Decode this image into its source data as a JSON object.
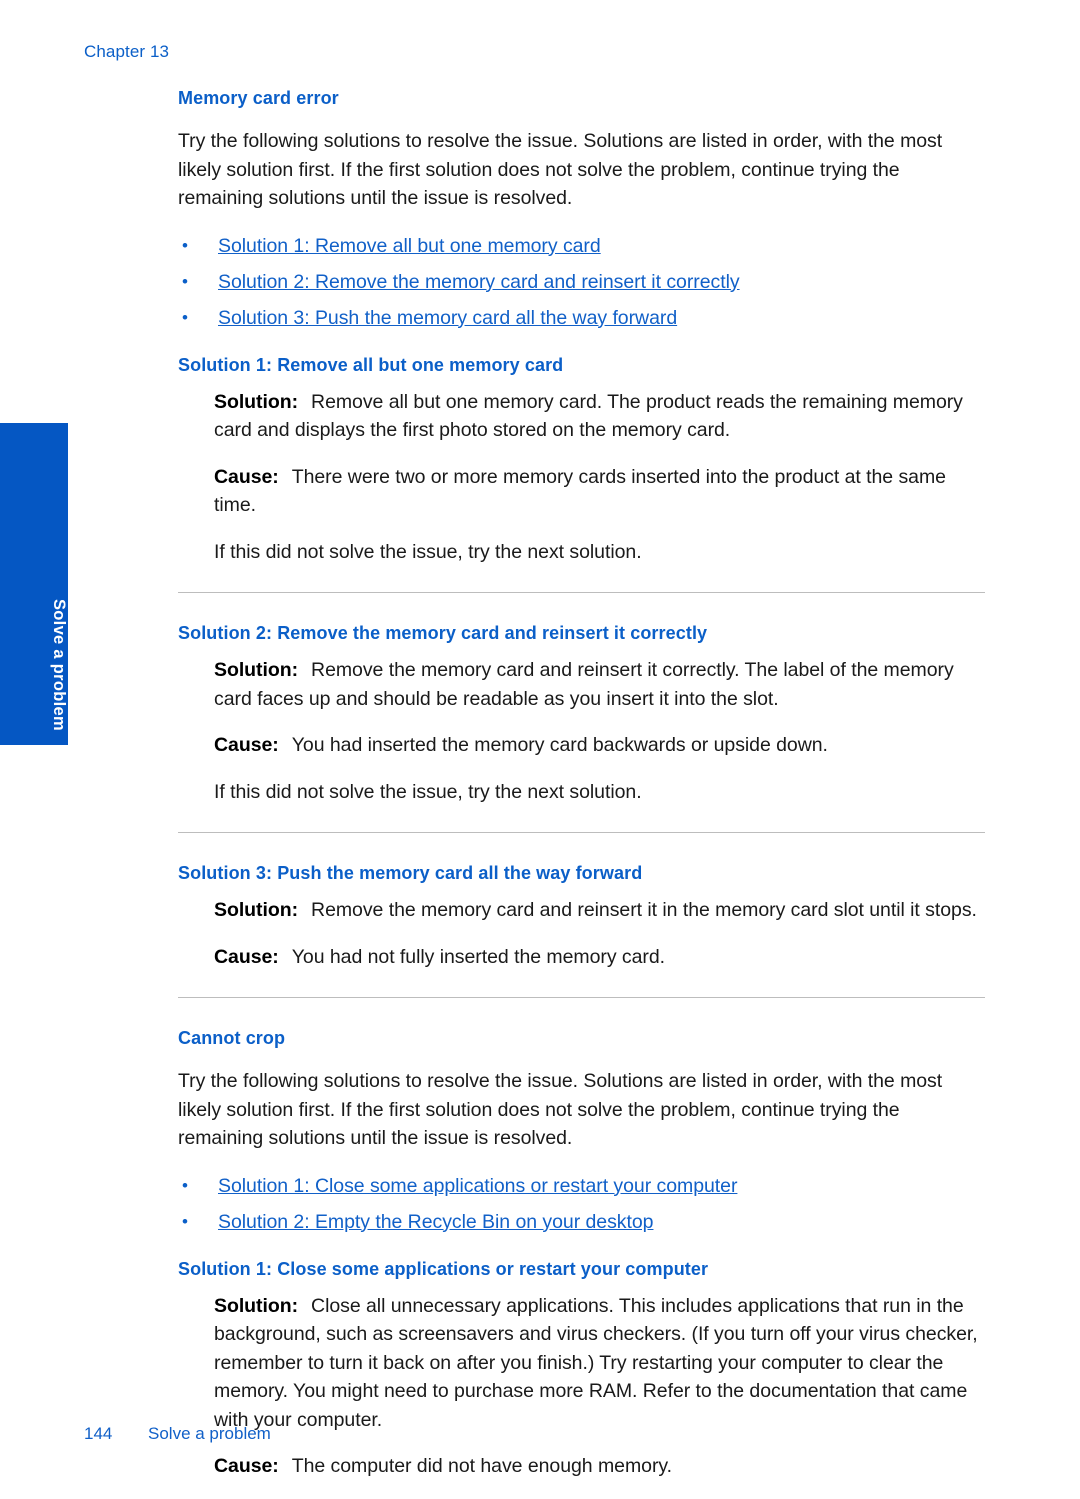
{
  "page": {
    "chapter_label": "Chapter 13",
    "side_tab_label": "Solve a problem",
    "footer_page_number": "144",
    "footer_section": "Solve a problem",
    "accent_blue": "#0B5FC8",
    "tab_blue": "#0557C3",
    "link_blue": "#1160C8",
    "rule_color": "#bdbdbd"
  },
  "sections": {
    "memory_card_error": {
      "title": "Memory card error",
      "intro": "Try the following solutions to resolve the issue. Solutions are listed in order, with the most likely solution first. If the first solution does not solve the problem, continue trying the remaining solutions until the issue is resolved.",
      "links": [
        "Solution 1: Remove all but one memory card",
        "Solution 2: Remove the memory card and reinsert it correctly",
        "Solution 3: Push the memory card all the way forward"
      ],
      "solutions": [
        {
          "heading": "Solution 1: Remove all but one memory card",
          "solution_label": "Solution:",
          "solution_text": "Remove all but one memory card. The product reads the remaining memory card and displays the first photo stored on the memory card.",
          "cause_label": "Cause:",
          "cause_text": "There were two or more memory cards inserted into the product at the same time.",
          "next_text": "If this did not solve the issue, try the next solution."
        },
        {
          "heading": "Solution 2: Remove the memory card and reinsert it correctly",
          "solution_label": "Solution:",
          "solution_text": "Remove the memory card and reinsert it correctly. The label of the memory card faces up and should be readable as you insert it into the slot.",
          "cause_label": "Cause:",
          "cause_text": "You had inserted the memory card backwards or upside down.",
          "next_text": "If this did not solve the issue, try the next solution."
        },
        {
          "heading": "Solution 3: Push the memory card all the way forward",
          "solution_label": "Solution:",
          "solution_text": "Remove the memory card and reinsert it in the memory card slot until it stops.",
          "cause_label": "Cause:",
          "cause_text": "You had not fully inserted the memory card.",
          "next_text": ""
        }
      ]
    },
    "cannot_crop": {
      "title": "Cannot crop",
      "intro": "Try the following solutions to resolve the issue. Solutions are listed in order, with the most likely solution first. If the first solution does not solve the problem, continue trying the remaining solutions until the issue is resolved.",
      "links": [
        "Solution 1: Close some applications or restart your computer",
        "Solution 2: Empty the Recycle Bin on your desktop"
      ],
      "solutions": [
        {
          "heading": "Solution 1: Close some applications or restart your computer",
          "solution_label": "Solution:",
          "solution_text": "Close all unnecessary applications. This includes applications that run in the background, such as screensavers and virus checkers. (If you turn off your virus checker, remember to turn it back on after you finish.) Try restarting your computer to clear the memory. You might need to purchase more RAM. Refer to the documentation that came with your computer.",
          "cause_label": "Cause:",
          "cause_text": "The computer did not have enough memory.",
          "next_text": ""
        }
      ]
    }
  }
}
